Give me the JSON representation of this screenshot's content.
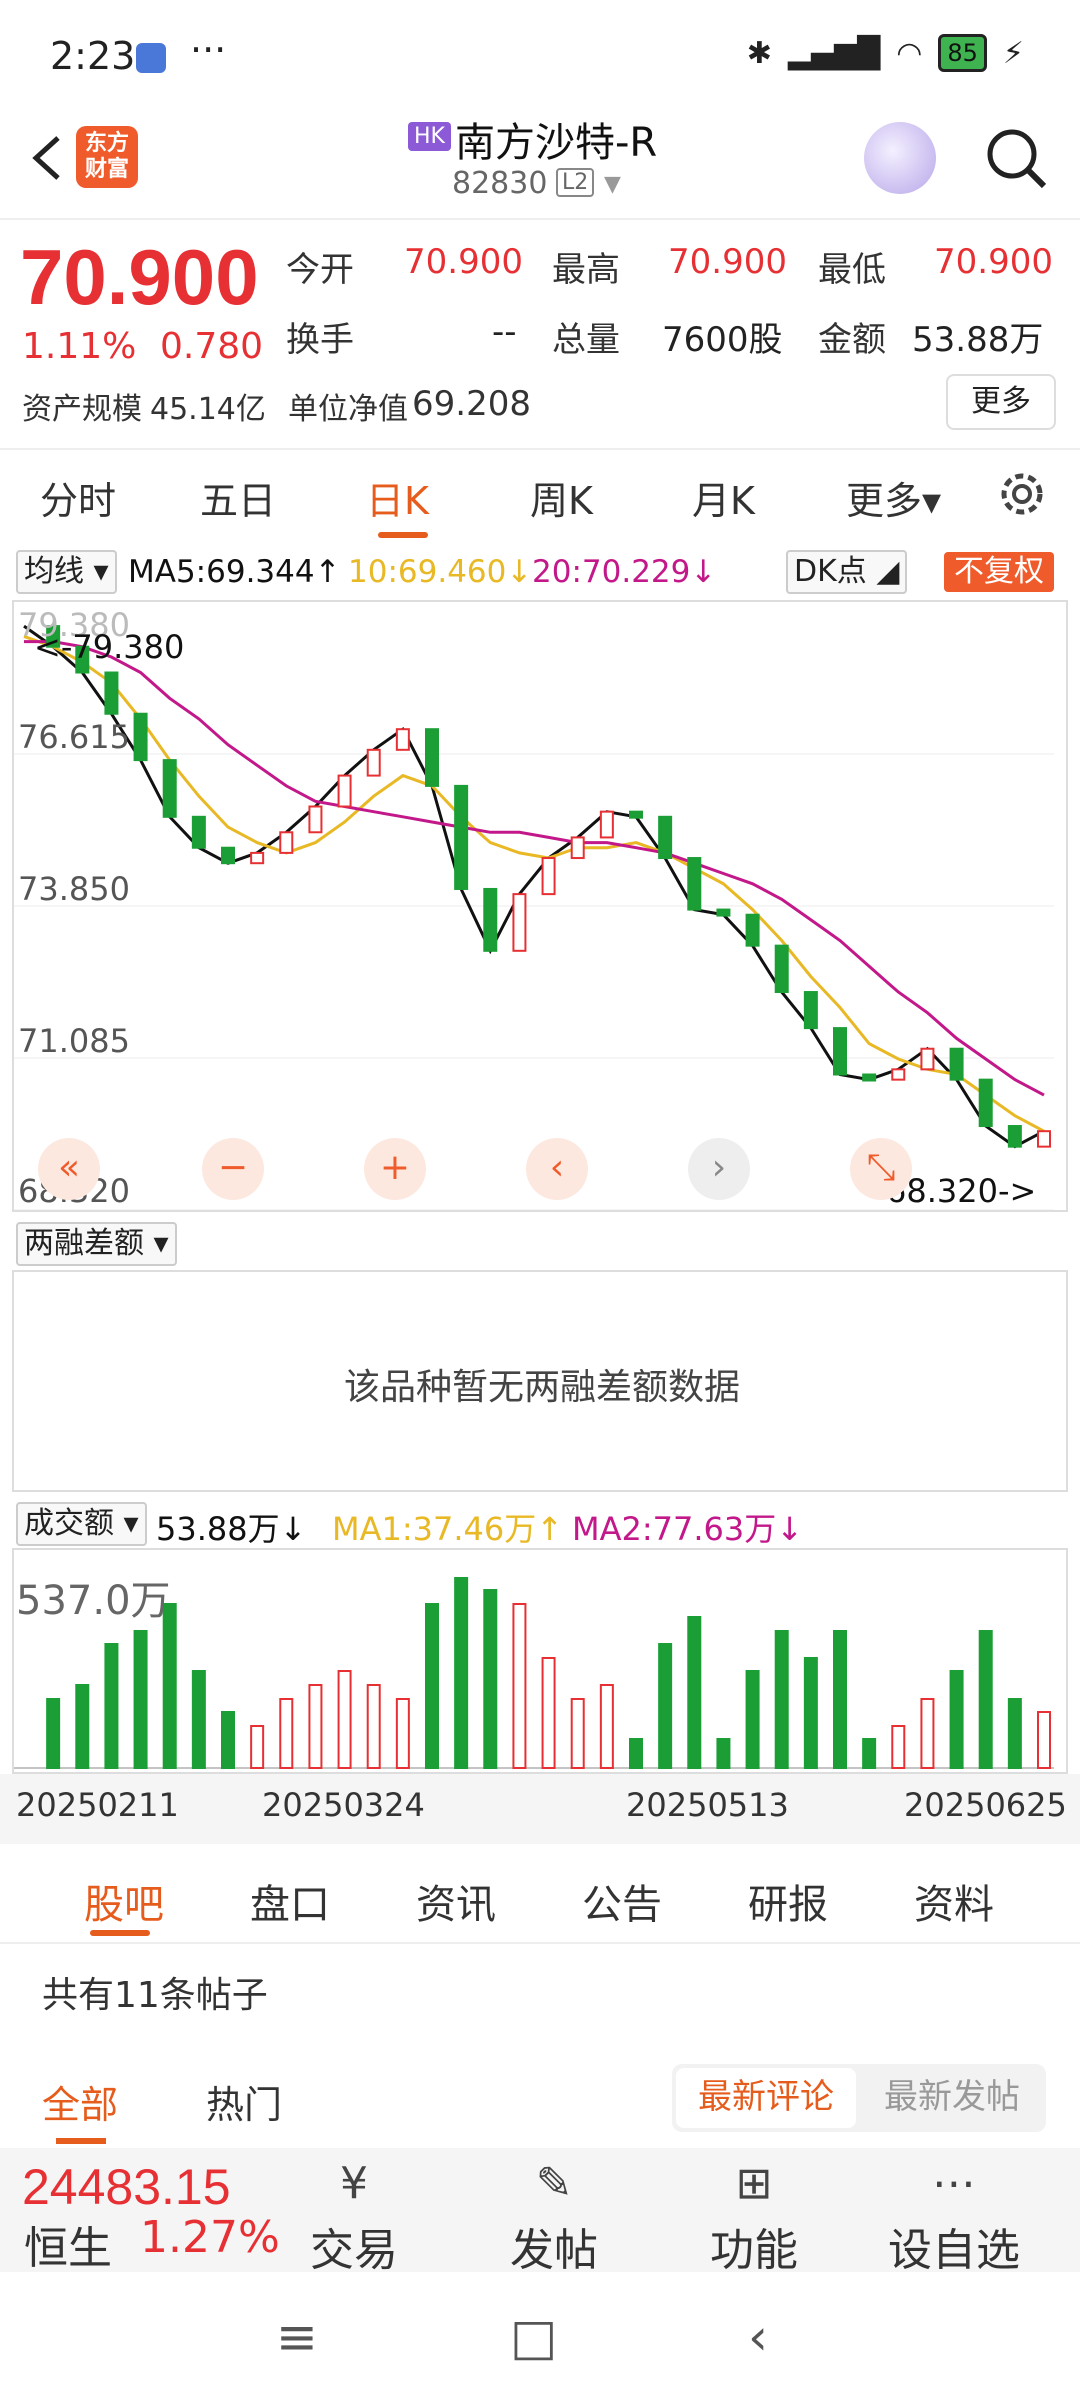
{
  "status": {
    "time": "2:23",
    "dots": "···",
    "battery": "85"
  },
  "header": {
    "logo_line1": "东方",
    "logo_line2": "财富",
    "market_tag": "HK",
    "name": "南方沙特-R",
    "code": "82830",
    "level": "L2"
  },
  "quote": {
    "price": "70.900",
    "pct": "1.11%",
    "change": "0.780",
    "open_label": "今开",
    "open": "70.900",
    "high_label": "最高",
    "high": "70.900",
    "low_label": "最低",
    "low": "70.900",
    "turnover_label": "换手",
    "turnover": "--",
    "volume_label": "总量",
    "volume": "7600股",
    "amount_label": "金额",
    "amount": "53.88万",
    "aum_label": "资产规模",
    "aum": "45.14亿",
    "nav_label": "单位净值",
    "nav": "69.208",
    "more": "更多"
  },
  "tabs": [
    "分时",
    "五日",
    "日K",
    "周K",
    "月K",
    "更多▾"
  ],
  "chart_toolbar": {
    "ma_dropdown": "均线",
    "ma5": "MA5:69.344↑",
    "ma10": "10:69.460↓",
    "ma20": "20:70.229↓",
    "dk": "DK点",
    "adjust": "不复权"
  },
  "kline_axis": [
    "79.380",
    "76.615",
    "73.850",
    "71.085",
    "68.320"
  ],
  "kline_annotations": {
    "high": "<-79.380",
    "low": "68.320->"
  },
  "margin": {
    "dropdown": "两融差额",
    "message": "该品种暂无两融差额数据"
  },
  "volume": {
    "dropdown": "成交额",
    "value": "53.88万↓",
    "ma1": "MA1:37.46万↑",
    "ma2": "MA2:77.63万↓",
    "max_label": "537.0万"
  },
  "dates": [
    "20250211",
    "20250324",
    "20250513",
    "20250625"
  ],
  "sections": [
    "股吧",
    "盘口",
    "资讯",
    "公告",
    "研报",
    "资料"
  ],
  "posts": {
    "count": "共有11条帖子",
    "all": "全部",
    "hot": "热门",
    "sort_new": "最新评论",
    "sort_post": "最新发帖"
  },
  "index": {
    "value": "24483.15",
    "name": "恒生",
    "pct": "1.27%"
  },
  "bottom_buttons": [
    "交易",
    "发帖",
    "功能",
    "设自选"
  ],
  "colors": {
    "up": "#e63033",
    "down": "#1a9e35",
    "ma5": "#111111",
    "ma10": "#e8b825",
    "ma20": "#c2188a",
    "accent": "#e65c1c"
  },
  "chart_data": {
    "type": "candlestick",
    "ylim": [
      68.32,
      79.38
    ],
    "ma_series": [
      {
        "name": "MA5",
        "values": [
          79.3,
          78.9,
          78.4,
          77.6,
          76.7,
          75.6,
          75.0,
          74.7,
          74.9,
          75.3,
          75.8,
          76.4,
          76.9,
          77.3,
          76.2,
          74.2,
          73.0,
          74.1,
          74.8,
          75.2,
          75.7,
          75.6,
          74.8,
          73.8,
          73.7,
          73.1,
          72.2,
          71.5,
          70.6,
          70.5,
          70.7,
          71.1,
          70.5,
          69.6,
          69.2,
          69.5
        ]
      },
      {
        "name": "MA10",
        "values": [
          79.1,
          78.9,
          78.6,
          78.2,
          77.5,
          76.7,
          76.0,
          75.4,
          75.1,
          74.9,
          75.1,
          75.5,
          76.0,
          76.4,
          76.2,
          75.6,
          75.1,
          74.9,
          74.8,
          75.0,
          75.0,
          75.1,
          74.9,
          74.6,
          74.3,
          73.8,
          73.2,
          72.5,
          71.9,
          71.2,
          70.9,
          70.7,
          70.6,
          70.2,
          69.8,
          69.5
        ]
      },
      {
        "name": "MA20",
        "values": [
          79.0,
          79.0,
          78.9,
          78.7,
          78.4,
          77.9,
          77.5,
          77.0,
          76.6,
          76.2,
          75.9,
          75.8,
          75.7,
          75.6,
          75.5,
          75.4,
          75.3,
          75.3,
          75.2,
          75.1,
          75.1,
          75.0,
          74.9,
          74.7,
          74.5,
          74.3,
          74.0,
          73.6,
          73.2,
          72.7,
          72.2,
          71.8,
          71.3,
          70.9,
          70.5,
          70.2
        ]
      }
    ],
    "volume_max": "537.0万"
  }
}
